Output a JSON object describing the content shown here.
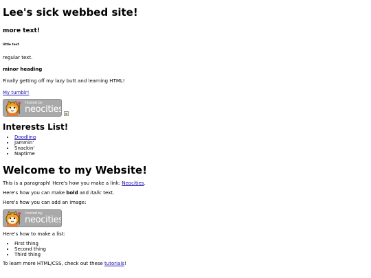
{
  "site_title": "Lee's sick webbed site!",
  "more_text": "more text!",
  "little_text": "little text",
  "regular_text": "regular text.",
  "minor_heading": "minor heading",
  "lazy_text": "Finally getting off my lazy butt and learning HTML!",
  "tumblr_link": "My tumblr!",
  "badge": {
    "hosted_by": "hosted by",
    "brand": "neocities"
  },
  "interests": {
    "heading": "Interests List!",
    "items": [
      {
        "label": "Doodling",
        "link": true
      },
      {
        "label": "Jammin'",
        "link": false
      },
      {
        "label": "Snackin'",
        "link": false
      },
      {
        "label": "Naptime",
        "link": false
      }
    ]
  },
  "welcome": {
    "heading": "Welcome to my Website!",
    "para1_before": "This is a paragraph! Here's how you make a link: ",
    "para1_link": "Neocities",
    "para1_after": ".",
    "para2_before": "Here's how you can make ",
    "para2_bold": "bold",
    "para2_mid": " and ",
    "para2_italic": "italic",
    "para2_after": " text.",
    "para3": "Here's how you can add an image:",
    "para4": "Here's how to make a list:",
    "list": [
      "First thing",
      "Second thing",
      "Third thing"
    ],
    "para5_before": "To learn more HTML/CSS, check out these ",
    "para5_link": "tutorials",
    "para5_after": "!"
  },
  "colors": {
    "link": "#1a0dab",
    "badge_bg": "#a9a9a9",
    "text": "#000000",
    "background": "#ffffff"
  }
}
